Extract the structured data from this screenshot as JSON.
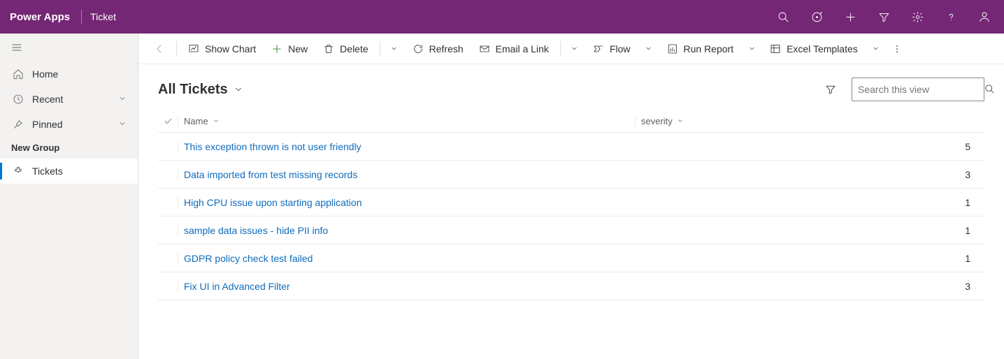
{
  "header": {
    "brand": "Power Apps",
    "app": "Ticket"
  },
  "sidebar": {
    "home": "Home",
    "recent": "Recent",
    "pinned": "Pinned",
    "group_label": "New Group",
    "tickets": "Tickets"
  },
  "commands": {
    "show_chart": "Show Chart",
    "new": "New",
    "delete": "Delete",
    "refresh": "Refresh",
    "email_link": "Email a Link",
    "flow": "Flow",
    "run_report": "Run Report",
    "excel_templates": "Excel Templates"
  },
  "view": {
    "title": "All Tickets",
    "search_placeholder": "Search this view"
  },
  "columns": {
    "name": "Name",
    "severity": "severity"
  },
  "rows": [
    {
      "name": "This exception thrown is not user friendly",
      "severity": "5"
    },
    {
      "name": "Data imported from test missing records",
      "severity": "3"
    },
    {
      "name": "High CPU issue upon starting application",
      "severity": "1"
    },
    {
      "name": "sample data issues - hide PII info",
      "severity": "1"
    },
    {
      "name": "GDPR policy check test failed",
      "severity": "1"
    },
    {
      "name": "Fix UI in Advanced Filter",
      "severity": "3"
    }
  ]
}
